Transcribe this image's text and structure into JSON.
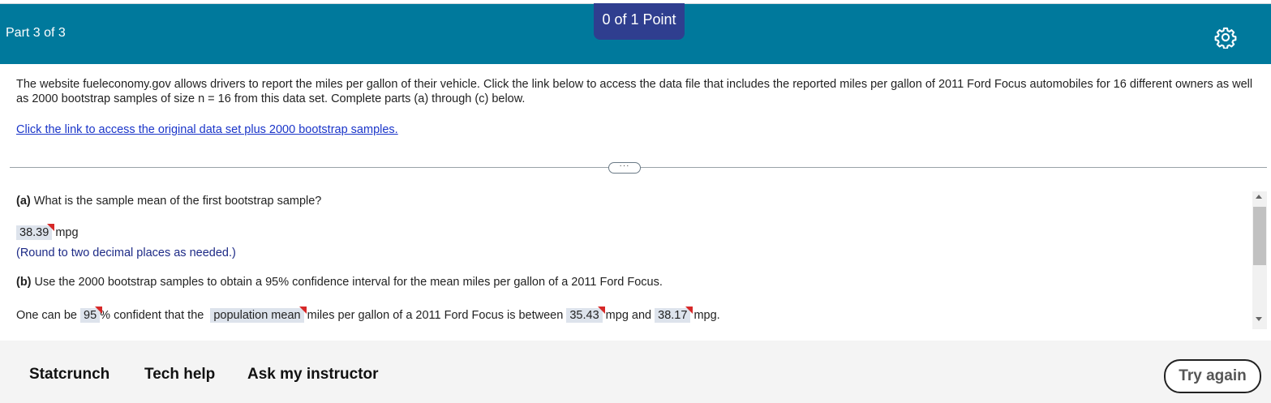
{
  "header": {
    "part_label": "Part 3 of 3",
    "points": "0 of 1 Point",
    "settings_icon": "gear-icon",
    "color": "#00799c",
    "badge_color": "#2f3e8f"
  },
  "intro": {
    "text": "The website fueleconomy.gov allows drivers to report the miles per gallon of their vehicle.  Click the link below to access the data file that includes the reported miles per gallon of 2011 Ford Focus automobiles for 16 different owners as well as 2000 bootstrap samples of size n =  16 from this data set. Complete parts (a) through (c) below.",
    "link": "Click the link to access the original data set plus 2000 bootstrap samples."
  },
  "more_button": "···",
  "part_a": {
    "label": "(a)",
    "question": " What is the sample mean of the first bootstrap sample?",
    "answer": "38.39",
    "unit": "mpg",
    "hint": "(Round to two decimal places as needed.)"
  },
  "part_b": {
    "label": "(b)",
    "question": " Use the 2000 bootstrap samples to obtain a 95% confidence interval for the mean miles per gallon of a 2011 Ford Focus.",
    "sentence_1": "One can be",
    "confidence": "95",
    "sentence_2": "% confident that the",
    "parameter": "population mean",
    "sentence_3": "miles per gallon of a 2011 Ford Focus is between",
    "lower": "35.43",
    "sentence_4": "mpg and",
    "upper": "38.17",
    "sentence_5": "mpg."
  },
  "footer": {
    "statcrunch": "Statcrunch",
    "tech_help": "Tech help",
    "ask_instructor": "Ask my instructor",
    "try_again": "Try again"
  }
}
